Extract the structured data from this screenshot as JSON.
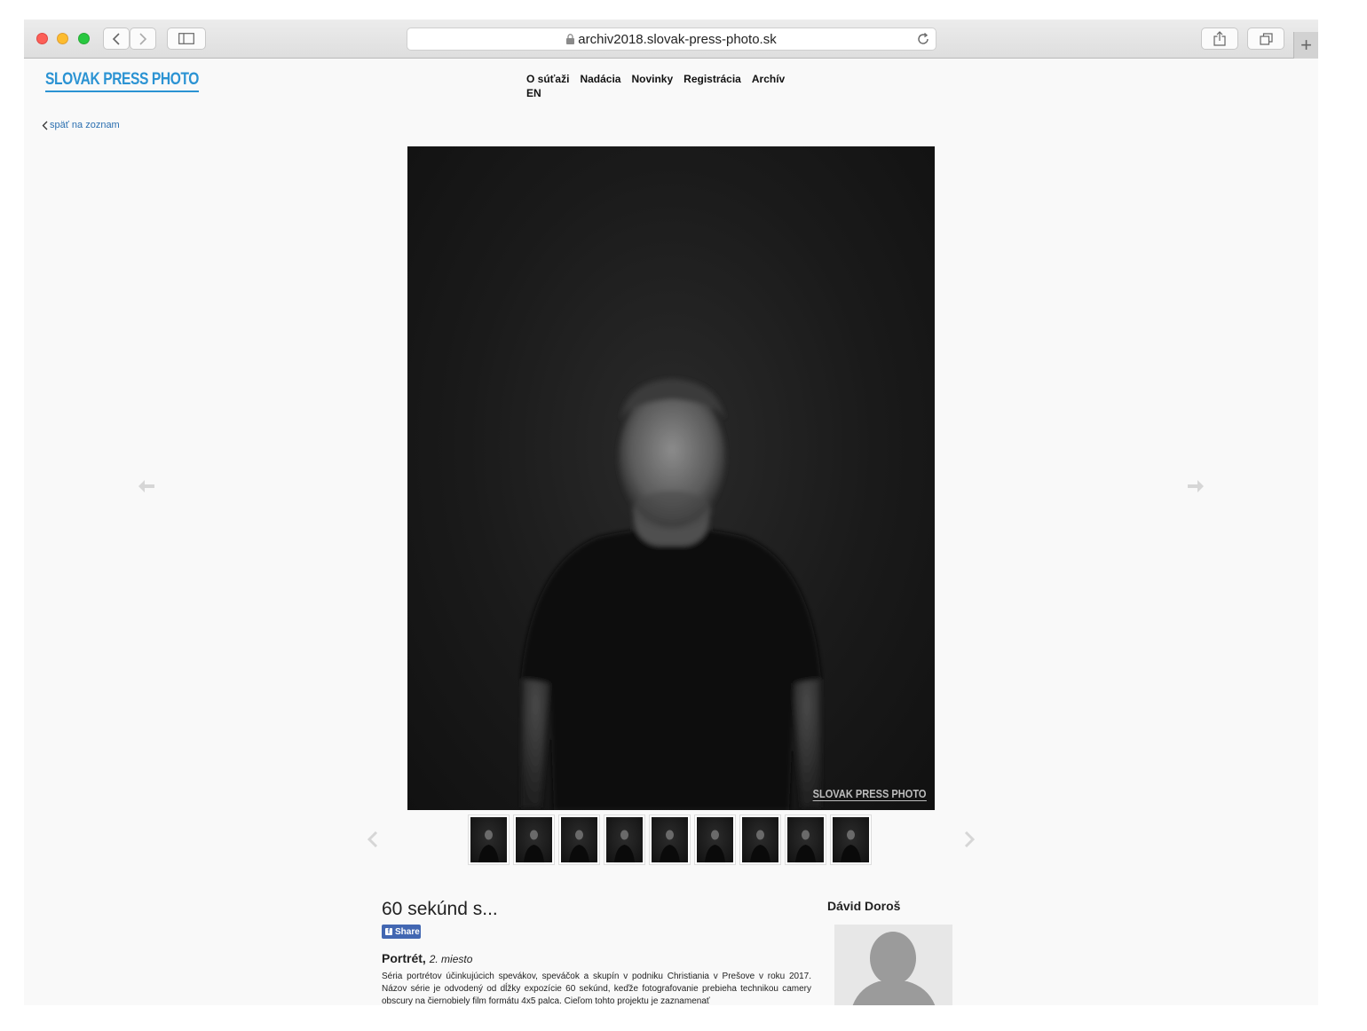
{
  "browser": {
    "url": "archiv2018.slovak-press-photo.sk"
  },
  "site": {
    "logo": "SLOVAK PRESS PHOTO",
    "nav": [
      "O súťaži",
      "Nadácia",
      "Novinky",
      "Registrácia",
      "Archív",
      "EN"
    ],
    "back_link": "späť na zoznam"
  },
  "photo": {
    "watermark": "SLOVAK PRESS PHOTO",
    "thumbnail_count": 9
  },
  "entry": {
    "title": "60 sekúnd s...",
    "share_label": "Share",
    "category": "Portrét,",
    "placement": "2. miesto",
    "description": "Séria portrétov účinkujúcich spevákov, speváčok a skupín v podniku Christiania v Prešove v roku 2017. Názov série je odvodený od dĺžky expozície 60 sekúnd, keďže fotografovanie prebieha technikou camery obscury na čiernobiely film formátu 4x5 palca. Cieľom tohto projektu je zaznamenať",
    "author": "Dávid Doroš"
  }
}
